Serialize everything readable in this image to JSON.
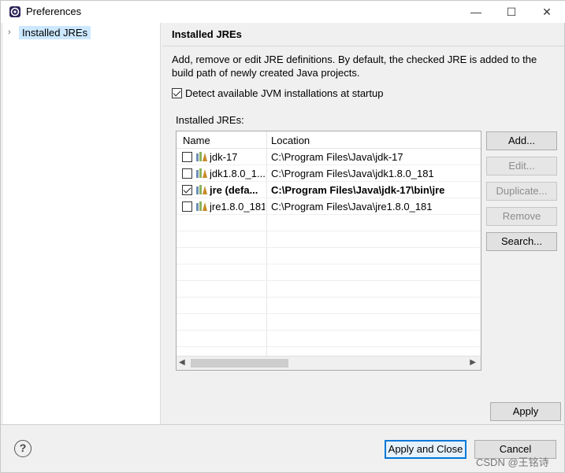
{
  "window": {
    "title": "Preferences",
    "controls": {
      "minimize": "—",
      "maximize": "☐",
      "close": "✕"
    }
  },
  "tree": {
    "items": [
      {
        "label": "Installed JREs",
        "selected": true
      }
    ]
  },
  "page": {
    "title": "Installed JREs",
    "description": "Add, remove or edit JRE definitions. By default, the checked JRE is added to the build path of newly created Java projects.",
    "detect_checkbox": {
      "label": "Detect available JVM installations at startup",
      "checked": true
    },
    "installed_label": "Installed JREs:"
  },
  "table": {
    "columns": [
      "Name",
      "Location"
    ],
    "rows": [
      {
        "name": "jdk-17",
        "location": "C:\\Program Files\\Java\\jdk-17",
        "checked": false,
        "default": false
      },
      {
        "name": "jdk1.8.0_1...",
        "location": "C:\\Program Files\\Java\\jdk1.8.0_181",
        "checked": false,
        "default": false
      },
      {
        "name": "jre (defa...",
        "location": "C:\\Program Files\\Java\\jdk-17\\bin\\jre",
        "checked": true,
        "default": true
      },
      {
        "name": "jre1.8.0_181",
        "location": "C:\\Program Files\\Java\\jre1.8.0_181",
        "checked": false,
        "default": false
      }
    ]
  },
  "buttons": {
    "add": "Add...",
    "edit": "Edit...",
    "duplicate": "Duplicate...",
    "remove": "Remove",
    "search": "Search...",
    "apply": "Apply",
    "apply_and_close": "Apply and Close",
    "cancel": "Cancel"
  },
  "help": {
    "symbol": "?"
  },
  "watermark": "CSDN @王铭诗",
  "colors": {
    "selection": "#cce8ff",
    "default_button_border": "#0078d7",
    "jre_icon": "#c88a2a"
  }
}
